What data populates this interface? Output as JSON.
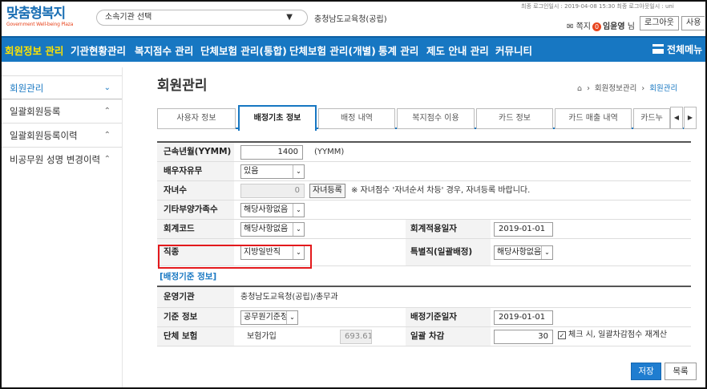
{
  "header": {
    "logo_main_1": "맞춤형",
    "logo_main_2": "복지",
    "logo_sub": "Government Well-being Plaza",
    "org_select": "소속기관 선택",
    "org_name": "충청남도교육청(공립)",
    "last_login": "최종 로그인일시 : 2019-04-08 15:30  최종 로그아웃일시 : uni",
    "message_label": "쪽지",
    "message_count": "0",
    "user_name": "임윤영",
    "user_suffix": "님",
    "logout": "로그아웃",
    "extra_btn": "사용"
  },
  "nav": {
    "items": [
      "회원정보 관리",
      "기관현황관리",
      "복지점수 관리",
      "단체보험 관리(통합)",
      "단체보험 관리(개별)",
      "통계 관리",
      "제도 안내 관리",
      "커뮤니티"
    ],
    "all_menu": "전체메뉴"
  },
  "sidebar": {
    "items": [
      {
        "label": "회원관리"
      },
      {
        "label": "일괄회원등록"
      },
      {
        "label": "일괄회원등록이력"
      },
      {
        "label": "비공무원 성명 변경이력"
      }
    ]
  },
  "page": {
    "title": "회원관리",
    "breadcrumb": [
      "회원정보관리",
      "회원관리"
    ]
  },
  "tabs": [
    "사용자 정보",
    "배정기초 정보",
    "배정 내역",
    "복지점수 이용",
    "카드 정보",
    "카드 매출 내역",
    "카드누"
  ],
  "form": {
    "service_months_label": "근속년월(YYMM)",
    "service_months_value": "1400",
    "service_months_unit": "(YYMM)",
    "spouse_label": "배우자유무",
    "spouse_value": "있음",
    "children_label": "자녀수",
    "children_value": "0",
    "children_btn": "자녀등록",
    "children_note": "※ 자녀점수 '자녀순서 차등' 경우, 자녀등록 바랍니다.",
    "other_family_label": "기타부양가족수",
    "other_family_value": "해당사항없음",
    "account_code_label": "회계코드",
    "account_code_value": "해당사항없음",
    "account_date_label": "회계적용일자",
    "account_date_value": "2019-01-01",
    "job_label": "직종",
    "job_value": "지방일반직",
    "special_label": "특별직(일괄배정)",
    "special_value": "해당사항없음"
  },
  "section2": {
    "title": "[배정기준 정보]",
    "org_label": "운영기관",
    "org_value": "충청남도교육청(공립)/총무과",
    "basis_label": "기준 정보",
    "basis_value": "공무원기준정보",
    "basis_date_label": "배정기준일자",
    "basis_date_value": "2019-01-01",
    "insurance_label": "단체 보험",
    "insurance_value": "보험가입",
    "insurance_amount": "693.61",
    "deduct_label": "일괄 차감",
    "deduct_value": "30",
    "deduct_check": "체크 시, 일괄차감점수 재계산"
  },
  "buttons": {
    "save": "저장",
    "list": "목록"
  }
}
